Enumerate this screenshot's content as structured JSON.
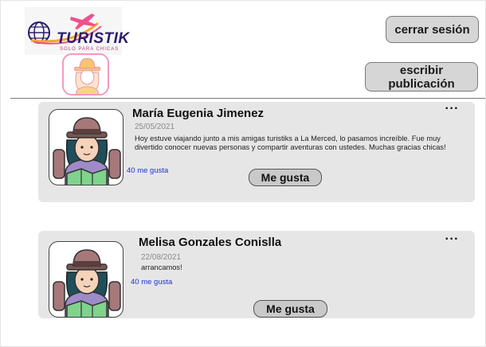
{
  "header": {
    "logo": {
      "brand": "TURISTIK",
      "tagline": "SOLO PARA CHICAS"
    },
    "logout_label": "cerrar sesión",
    "write_post_label": "escribir publicación"
  },
  "posts": [
    {
      "author": "María Eugenia Jimenez",
      "date": "25/05/2021",
      "text": "Hoy estuve viajando junto a mis amigas turistiks a La Merced, lo pasamos increíble. Fue muy divertido conocer nuevas personas y compartir aventuras con ustedes. Muchas gracias chicas!",
      "likes": "40 me gusta",
      "like_button": "Me gusta",
      "more": "···"
    },
    {
      "author": "Melisa Gonzales Conislla",
      "date": "22/08/2021",
      "text": "arrancamos!",
      "likes": "40 me gusta",
      "like_button": "Me gusta",
      "more": "···"
    }
  ],
  "colors": {
    "accent_blue": "#1a32d6",
    "card_bg": "#e7e6e6",
    "button_bg": "#d6d6d6",
    "logo_pink": "#f0508c",
    "logo_orange": "#f7a823"
  },
  "icons": {
    "logo": "globe-plane-logo",
    "avatar": "traveler-woman-avatar",
    "more": "ellipsis-icon"
  }
}
